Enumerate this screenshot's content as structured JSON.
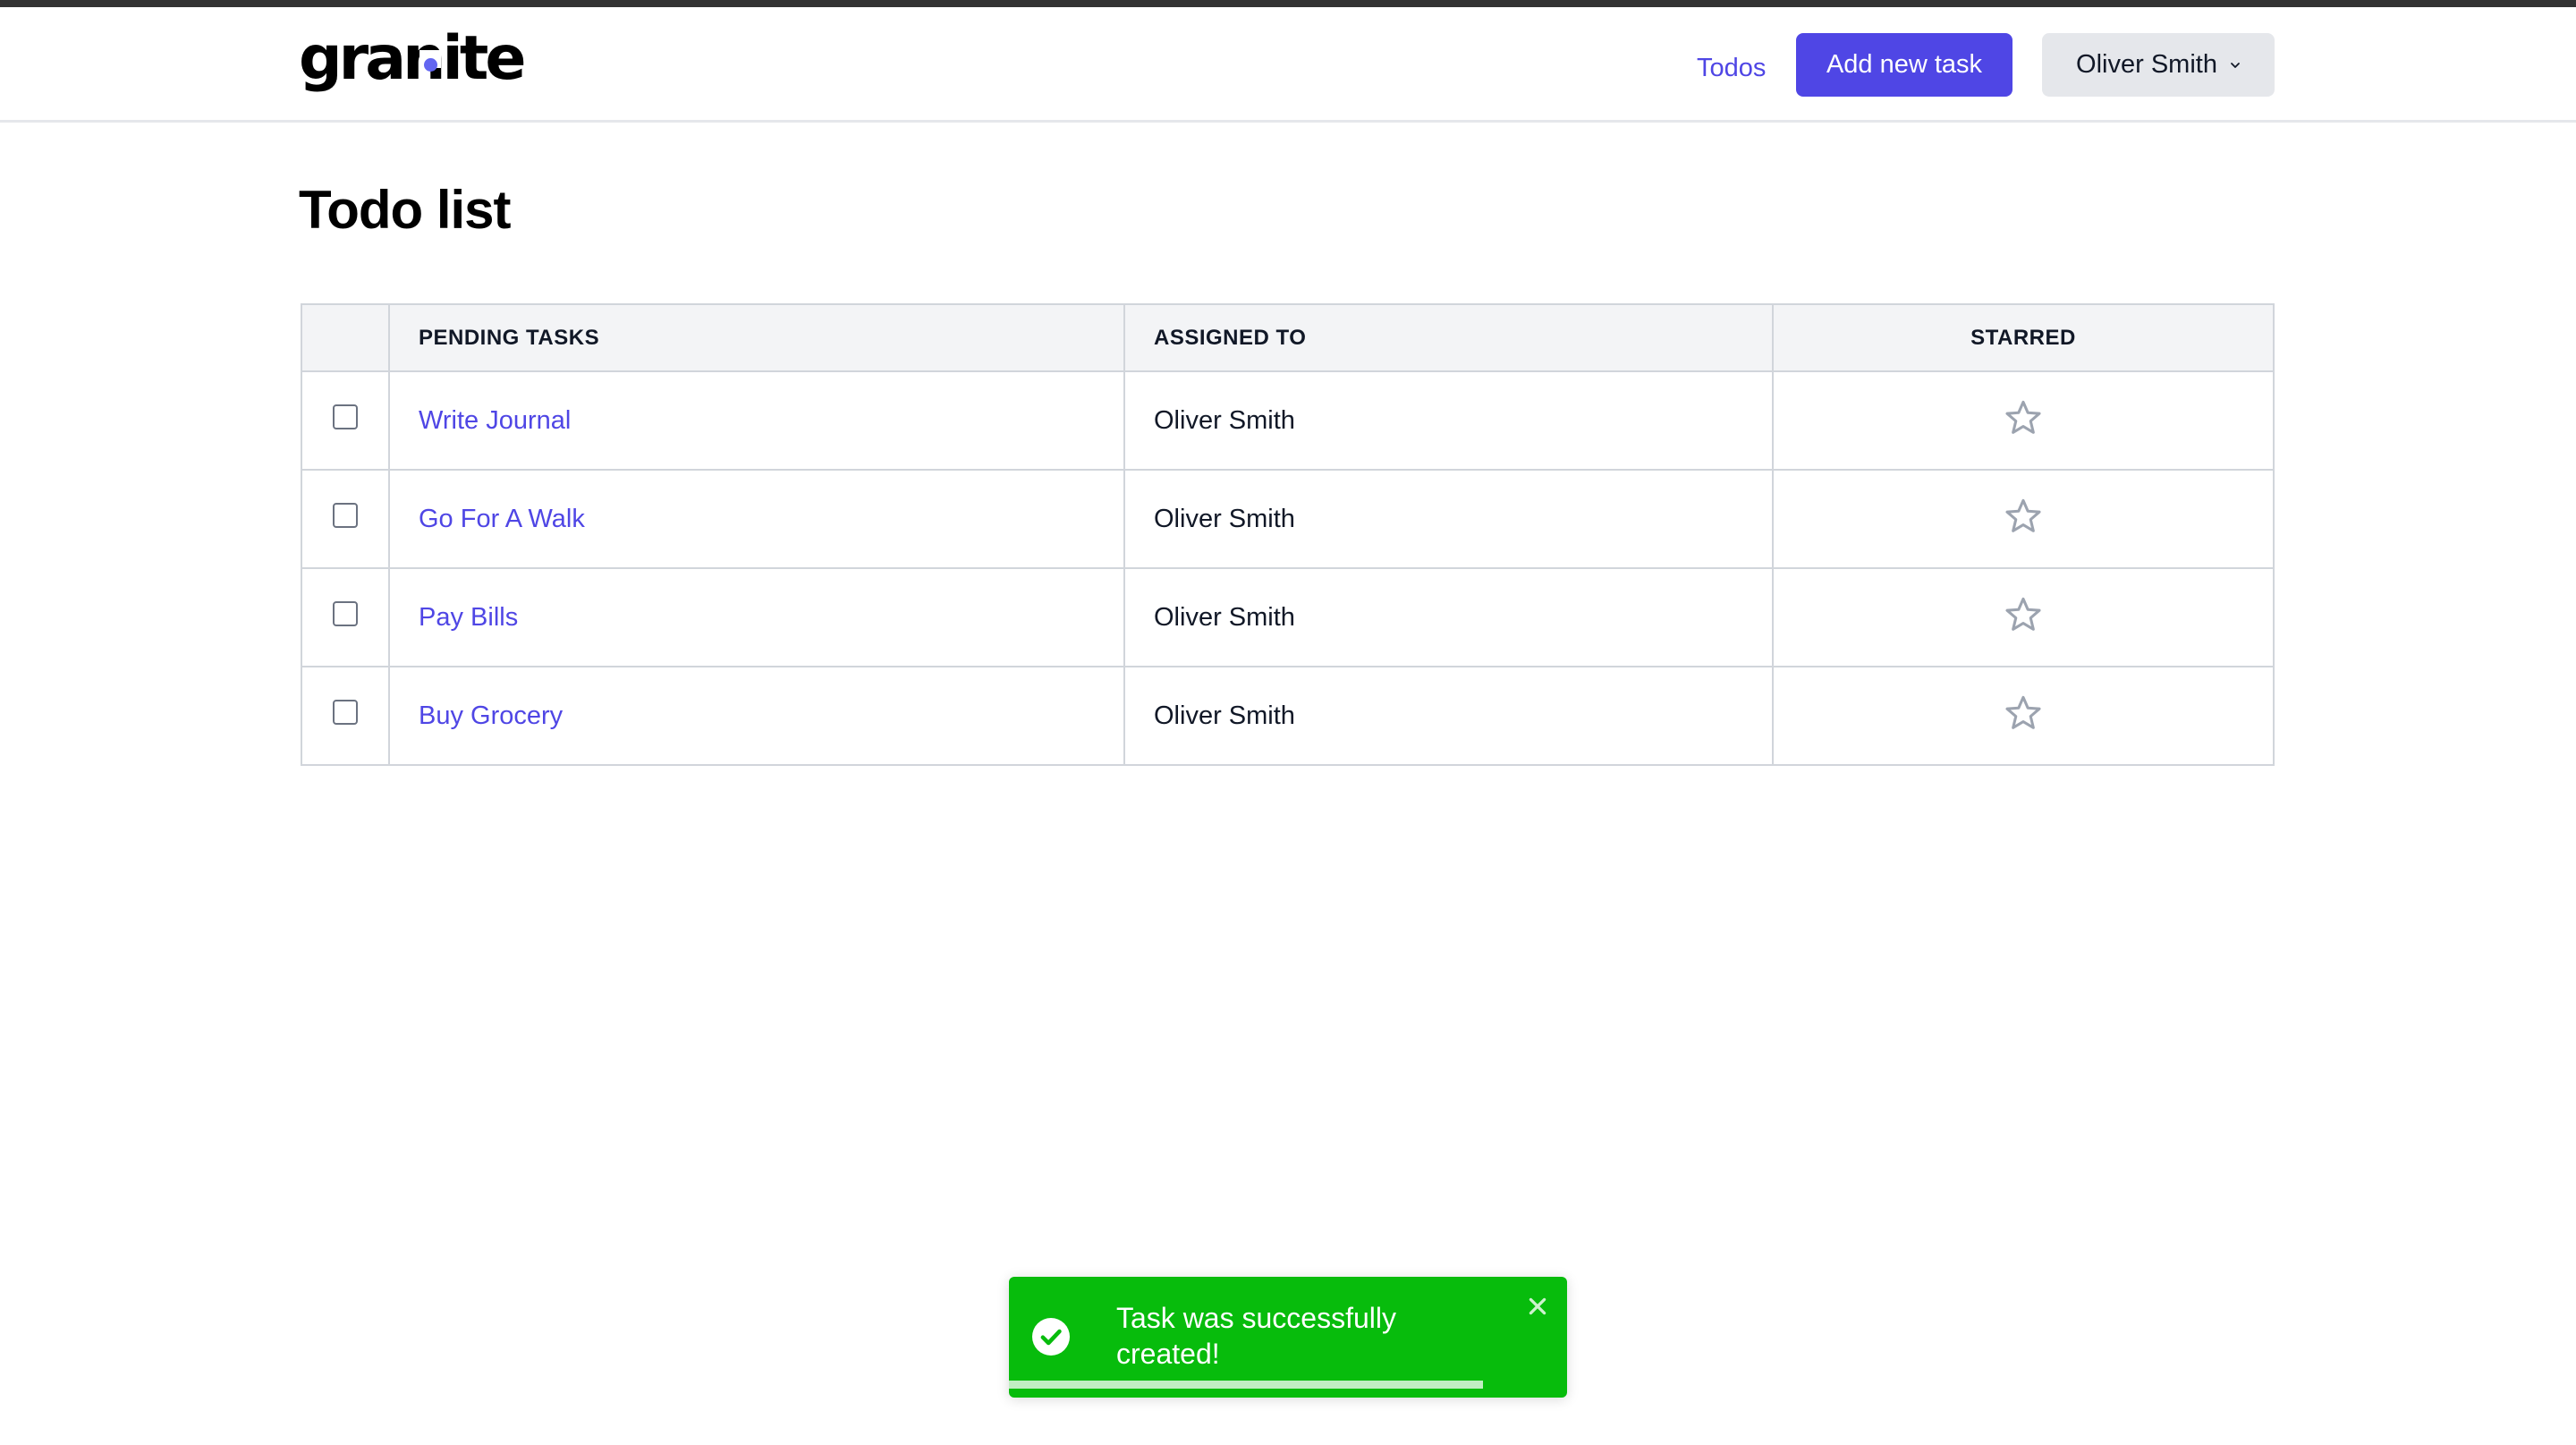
{
  "header": {
    "logo_text": "granite",
    "nav_todos": "Todos",
    "add_task_label": "Add new task",
    "user_menu_label": "Oliver Smith"
  },
  "main": {
    "title": "Todo list",
    "table": {
      "columns": [
        "",
        "PENDING TASKS",
        "ASSIGNED TO",
        "STARRED"
      ],
      "rows": [
        {
          "title": "Write Journal",
          "assigned_to": "Oliver Smith",
          "checked": false,
          "starred": false
        },
        {
          "title": "Go For A Walk",
          "assigned_to": "Oliver Smith",
          "checked": false,
          "starred": false
        },
        {
          "title": "Pay Bills",
          "assigned_to": "Oliver Smith",
          "checked": false,
          "starred": false
        },
        {
          "title": "Buy Grocery",
          "assigned_to": "Oliver Smith",
          "checked": false,
          "starred": false
        }
      ]
    }
  },
  "toast": {
    "type": "success",
    "message": "Task was successfully created!",
    "icon": "check-circle-icon",
    "close_icon": "close-icon",
    "progress_remaining": 0.85
  },
  "colors": {
    "brand": "#4f46e5",
    "logo_dot": "#6366f1",
    "toast_success": "#07bc0c",
    "header_bg": "#f3f4f6",
    "border": "#d1d5db"
  }
}
